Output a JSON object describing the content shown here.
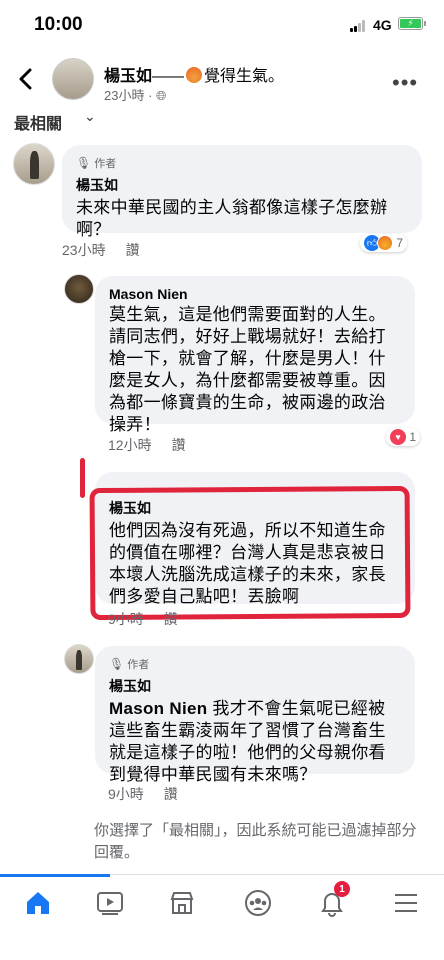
{
  "status_bar": {
    "time": "10:00",
    "network": "4G"
  },
  "header": {
    "name": "楊玉如",
    "feeling_prefix": "——",
    "feeling": "覺得生氣。",
    "time": "23小時 ·"
  },
  "sort": {
    "label": "最相關"
  },
  "comments": [
    {
      "badge": "作者",
      "name": "楊玉如",
      "text": "未來中華民國的主人翁都像這樣子怎麼辦啊？",
      "time": "23小時",
      "reply": "讚",
      "reaction_count": "7"
    },
    {
      "name": "Mason Nien",
      "text": "莫生氣，這是他們需要面對的人生。請同志們，好好上戰場就好！去給打槍一下，就會了解，什麼是男人！什麼是女人，為什麼都需要被尊重。因為都一條寶貴的生命，被兩邊的政治操弄！",
      "time": "12小時",
      "reply": "讚",
      "reaction_count": "1"
    },
    {
      "name": "楊玉如",
      "text": "他們因為沒有死過，所以不知道生命的價值在哪裡？台灣人真是悲哀被日本壞人洗腦洗成這樣子的未來，家長們多愛自己點吧！丟臉啊",
      "time": "9小時",
      "reply": "讚"
    },
    {
      "badge": "作者",
      "name": "楊玉如",
      "mention": "Mason Nien",
      "text": " 我才不會生氣呢已經被這些畜生霸淩兩年了習慣了台灣畜生就是這樣子的啦！他們的父母親你看到覺得中華民國有未來嗎？",
      "time": "9小時",
      "reply": "讚"
    }
  ],
  "filter_note": "你選擇了「最相關」，因此系統可能已過濾掉部分回覆。",
  "nav": {
    "notifications_badge": "1"
  },
  "colors": {
    "accent": "#1877f2",
    "highlight": "#e0243c"
  }
}
